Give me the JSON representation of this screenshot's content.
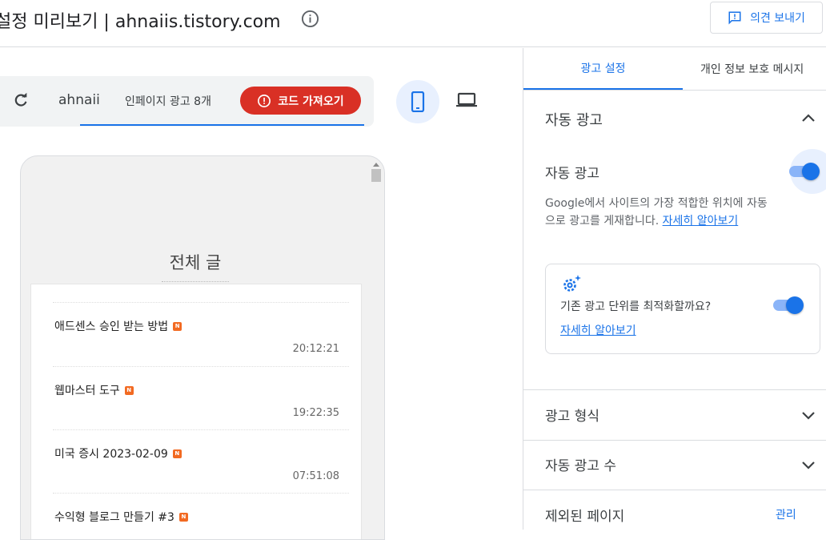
{
  "header": {
    "title": "설정 미리보기 | ahnaiis.tistory.com",
    "feedback_label": "의견 보내기"
  },
  "preview": {
    "site_name": "ahnaii",
    "inpage_ads_label": "인페이지 광고 8개",
    "get_code_label": "코드 가져오기",
    "page_heading": "전체 글",
    "posts": [
      {
        "title": "애드센스 승인 받는 방법",
        "time": "20:12:21",
        "badge": "N"
      },
      {
        "title": "웹마스터 도구",
        "time": "19:22:35",
        "badge": "N"
      },
      {
        "title": "미국 증시 2023-02-09",
        "time": "07:51:08",
        "badge": "N"
      },
      {
        "title": "수익형 블로그 만들기 #3",
        "time": "",
        "badge": "N"
      }
    ]
  },
  "sidebar": {
    "tabs": [
      {
        "label": "광고 설정",
        "active": true
      },
      {
        "label": "개인 정보 보호 메시지",
        "active": false
      }
    ],
    "auto_ads_section_title": "자동 광고",
    "auto_ads_toggle_label": "자동 광고",
    "auto_ads_enabled": true,
    "auto_ads_desc": "Google에서 사이트의 가장 적합한 위치에 자동으로 광고를 게재합니다.",
    "learn_more_inline": "자세히 알아보기",
    "optimize_question": "기존 광고 단위를 최적화할까요?",
    "optimize_enabled": true,
    "optimize_learn_more": "자세히 알아보기",
    "ad_formats_title": "광고 형식",
    "ad_load_title": "자동 광고 수",
    "excluded_pages_title": "제외된 페이지",
    "manage_label": "관리"
  },
  "colors": {
    "accent": "#1a73e8",
    "danger": "#d93025",
    "new_badge": "#f26a22"
  }
}
